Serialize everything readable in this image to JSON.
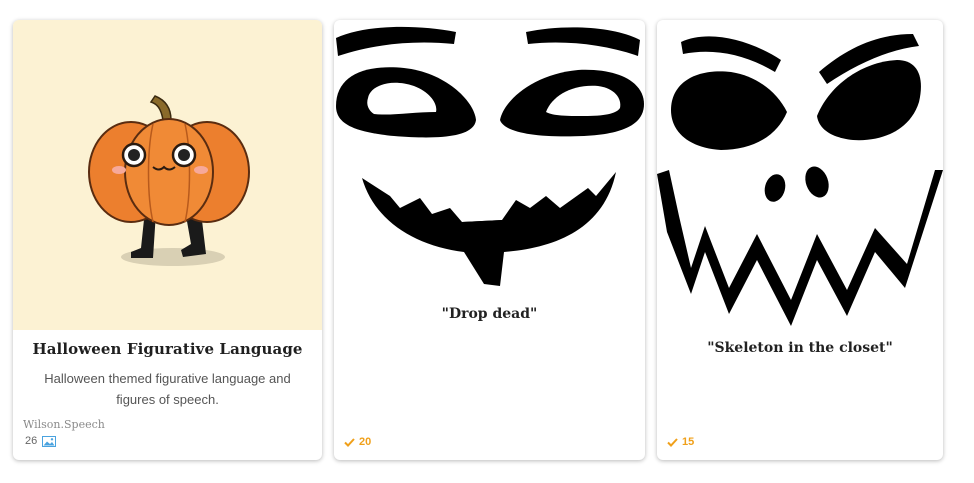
{
  "cards": [
    {
      "title": "Halloween Figurative Language",
      "description": "Halloween themed figurative language and figures of speech.",
      "author": "Wilson.Speech",
      "count": "26",
      "count_icon": "image-icon",
      "thumbnail": "pumpkin-character-illustration"
    },
    {
      "caption": "\"Drop dead\"",
      "check_count": "20",
      "check_icon": "checkmark-icon",
      "thumbnail": "jack-o-lantern-face"
    },
    {
      "caption": "\"Skeleton in the closet\"",
      "check_count": "15",
      "check_icon": "checkmark-icon",
      "thumbnail": "angry-jack-o-lantern-face"
    }
  ],
  "colors": {
    "accent_check": "#f0a01a",
    "thumb_background": "#fcf2d3",
    "pumpkin_orange": "#f08a36"
  }
}
